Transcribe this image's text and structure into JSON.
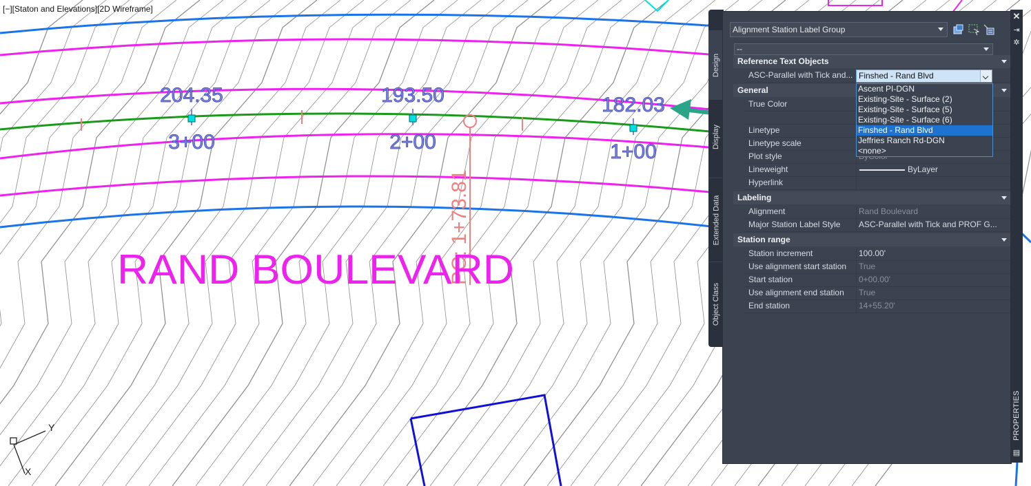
{
  "viewport": {
    "label": "[−][Staton and Elevations][2D Wireframe]",
    "street_name": "RAND BOULEVARD",
    "pc_label": "PC: 1+73.81",
    "stations": [
      {
        "station": "3+00",
        "elevation": "204.35"
      },
      {
        "station": "2+00",
        "elevation": "193.50"
      },
      {
        "station": "1+00",
        "elevation": "182.03"
      }
    ],
    "ucs": {
      "x_label": "X",
      "y_label": "Y"
    },
    "colors": {
      "contour": "#8a8a8a",
      "offset_line": "#ee22ee",
      "right_of_way": "#1a73e8",
      "alignment": "#1a9a1a",
      "label_text": "#7d86e0",
      "pc_label": "#f08080",
      "arrow": "#2aa58a",
      "parcel": "#1010d8",
      "grip": "#00e0e0"
    }
  },
  "palette": {
    "title": "PROPERTIES",
    "selector": {
      "value": "Alignment Station Label Group"
    },
    "tabs": [
      {
        "label": "Design"
      },
      {
        "label": "Display"
      },
      {
        "label": "Extended Data"
      },
      {
        "label": "Object Class"
      }
    ],
    "top_combo": {
      "value": "--"
    },
    "sections": {
      "reference": {
        "title": "Reference Text Objects",
        "row_name": "ASC-Parallel with Tick and...",
        "row_value": "Finshed - Rand Blvd",
        "options": [
          "Ascent PI-DGN",
          "Existing-Site - Surface (2)",
          "Existing-Site - Surface (5)",
          "Existing-Site - Surface (6)",
          "Finshed - Rand Blvd",
          "Jeffries Ranch Rd-DGN",
          "<none>"
        ],
        "selected_index": 4
      },
      "general": {
        "title": "General",
        "rows": [
          {
            "name": "True Color",
            "value": ""
          },
          {
            "name": "",
            "value": ""
          },
          {
            "name": "Linetype",
            "value": ""
          },
          {
            "name": "Linetype scale",
            "value": ""
          },
          {
            "name": "Plot style",
            "value": "ByColor"
          },
          {
            "name": "Lineweight",
            "value": "ByLayer"
          },
          {
            "name": "Hyperlink",
            "value": ""
          }
        ]
      },
      "labeling": {
        "title": "Labeling",
        "rows": [
          {
            "name": "Alignment",
            "value": "Rand Boulevard"
          },
          {
            "name": "Major Station Label Style",
            "value": "ASC-Parallel with Tick and PROF G..."
          }
        ]
      },
      "station_range": {
        "title": "Station range",
        "rows": [
          {
            "name": "Station increment",
            "value": "100.00'"
          },
          {
            "name": "Use alignment start station",
            "value": "True"
          },
          {
            "name": "Start station",
            "value": "0+00.00'"
          },
          {
            "name": "Use alignment end station",
            "value": "True"
          },
          {
            "name": "End station",
            "value": "14+55.20'"
          }
        ]
      }
    }
  }
}
